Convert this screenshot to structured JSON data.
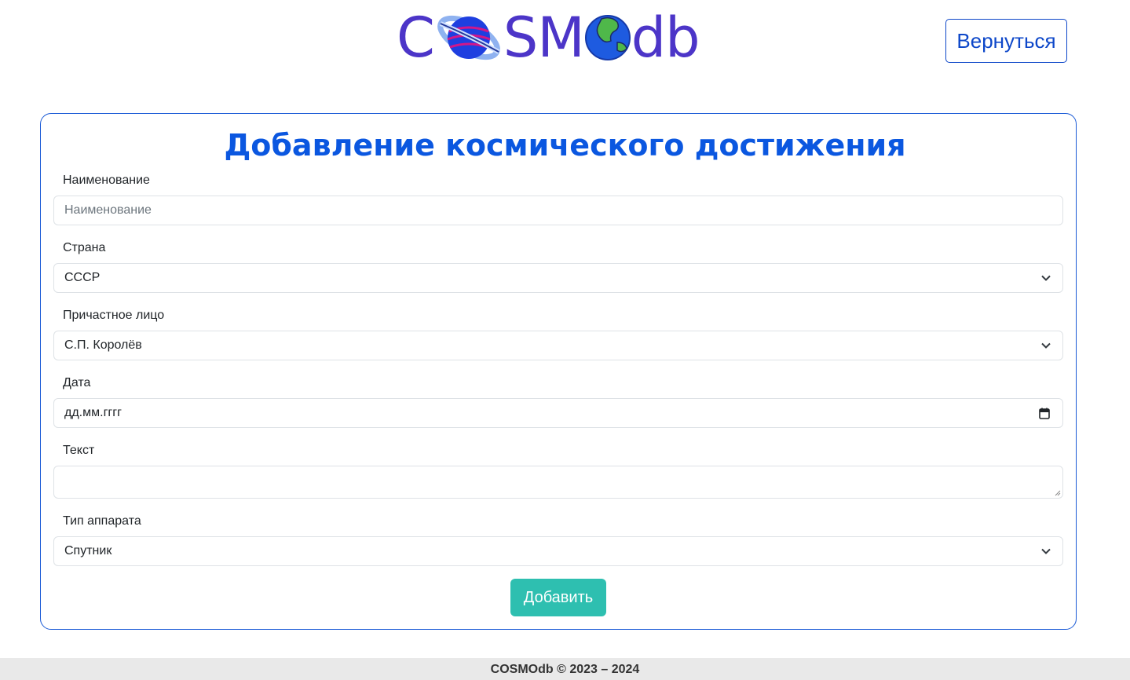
{
  "header": {
    "logo_letters": [
      "C",
      "SM",
      "db"
    ],
    "back_label": "Вернуться"
  },
  "form": {
    "title": "Добавление космического достижения",
    "name": {
      "label": "Наименование",
      "placeholder": "Наименование"
    },
    "country": {
      "label": "Страна",
      "value": "СССР"
    },
    "person": {
      "label": "Причастное лицо",
      "value": "С.П. Королёв"
    },
    "date": {
      "label": "Дата",
      "value": "дд.мм.гггг"
    },
    "text": {
      "label": "Текст",
      "value": ""
    },
    "type": {
      "label": "Тип аппарата",
      "value": "Спутник"
    },
    "submit_label": "Добавить"
  },
  "footer": {
    "text": "COSMOdb © 2023 – 2024"
  },
  "colors": {
    "accent": "#0b57e0",
    "logo": "#4c35c8",
    "submit": "#2ebfb0",
    "border": "#1a5ad6"
  }
}
